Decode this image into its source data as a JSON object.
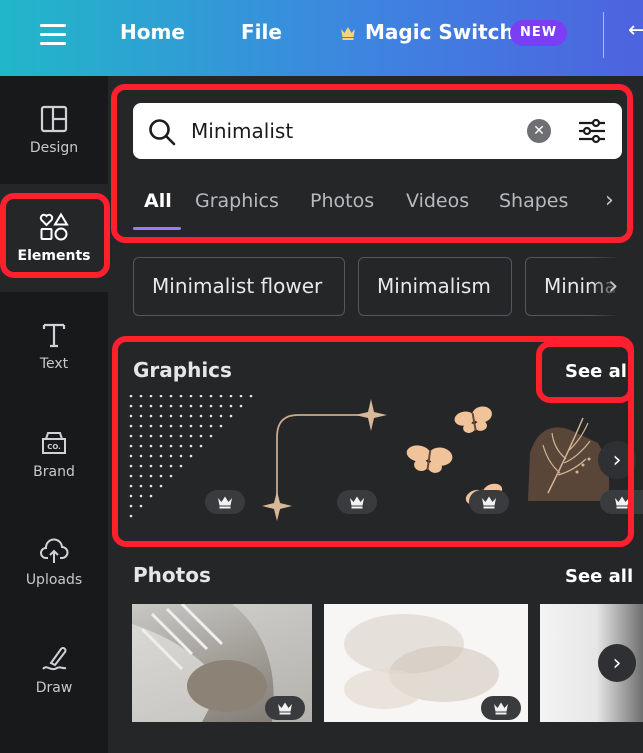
{
  "topbar": {
    "menu_icon": "hamburger-menu-icon",
    "home": "Home",
    "file": "File",
    "magic_switch": "Magic Switch",
    "new_badge": "NEW",
    "gradient_colors": [
      "#21b7c9",
      "#3d86e0",
      "#4d63df"
    ]
  },
  "sidebar": {
    "items": [
      {
        "label": "Design",
        "icon": "layout-icon"
      },
      {
        "label": "Elements",
        "icon": "shapes-icon"
      },
      {
        "label": "Text",
        "icon": "text-T-icon"
      },
      {
        "label": "Brand",
        "icon": "brand-kit-icon"
      },
      {
        "label": "Uploads",
        "icon": "cloud-upload-icon"
      },
      {
        "label": "Draw",
        "icon": "pen-draw-icon"
      }
    ],
    "active": "Elements"
  },
  "search": {
    "value": "Minimalist",
    "icon": "search-icon",
    "clear_icon": "clear-x-icon",
    "filter_icon": "filter-sliders-icon"
  },
  "tabs": [
    "All",
    "Graphics",
    "Photos",
    "Videos",
    "Shapes"
  ],
  "active_tab": "All",
  "suggestions": [
    "Minimalist flower",
    "Minimalism",
    "Minima"
  ],
  "sections": {
    "graphics": {
      "title": "Graphics",
      "see_all": "See all"
    },
    "photos": {
      "title": "Photos",
      "see_all": "See all"
    }
  },
  "highlight_color": "#ff1f2e",
  "accent_color": "#7b3ef4"
}
